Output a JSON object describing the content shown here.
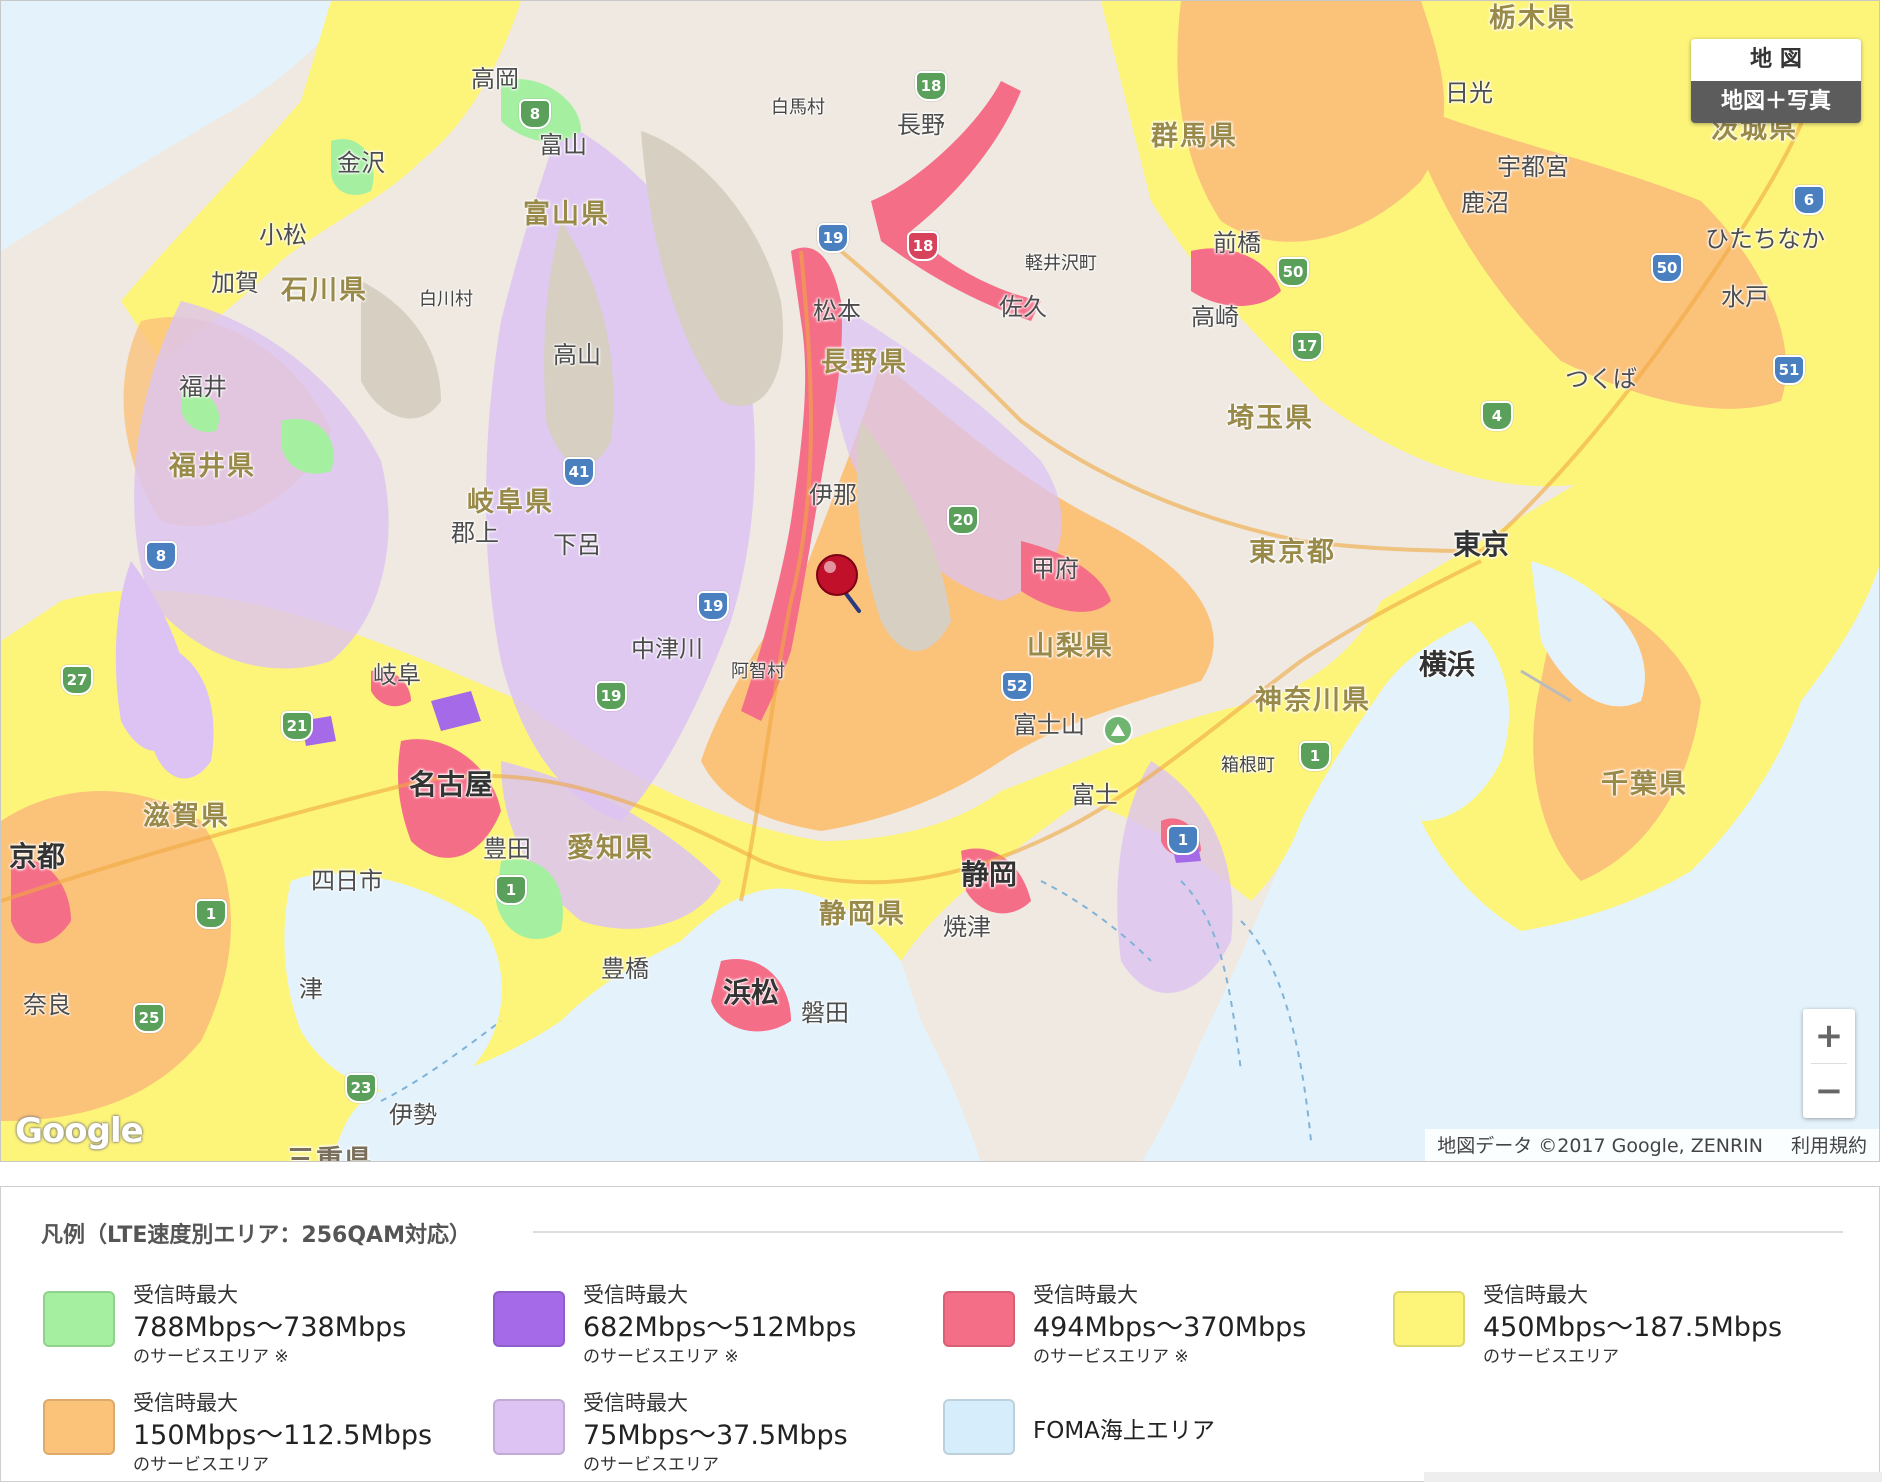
{
  "map": {
    "map_type": {
      "option_map": "地 図",
      "option_hybrid": "地図＋写真",
      "selected": "地図＋写真"
    },
    "zoom": {
      "in": "+",
      "out": "−"
    },
    "google_logo": "Google",
    "attribution": "地図データ ©2017 Google, ZENRIN",
    "terms": "利用規約",
    "colors": {
      "sea": "#e4f3fb",
      "land_base": "#efe9e1",
      "mountain": "#d6cfc2",
      "yellow": "#fdf57a",
      "orange": "#fbc27a",
      "pink": "#f56e88",
      "light_purple": "#dcc3f3",
      "purple": "#a56ae8",
      "green": "#a4f0a0"
    },
    "prefectures": [
      "栃木県",
      "群馬県",
      "富山県",
      "石川県",
      "長野県",
      "茨城県",
      "埼玉県",
      "福井県",
      "岐阜県",
      "東京都",
      "山梨県",
      "神奈川県",
      "千葉県",
      "滋賀県",
      "愛知県",
      "静岡県",
      "京都",
      "三重県"
    ],
    "cities": [
      "高岡",
      "富山",
      "金沢",
      "小松",
      "加賀",
      "白川村",
      "高山",
      "白馬村",
      "長野",
      "日光",
      "宇都宮",
      "鹿沼",
      "前橋",
      "高崎",
      "軽井沢町",
      "佐久",
      "松本",
      "ひたちなか",
      "水戸",
      "つくば",
      "伊那",
      "郡上",
      "下呂",
      "中津川",
      "阿智村",
      "甲府",
      "岐阜",
      "名古屋",
      "豊田",
      "四日市",
      "富士山",
      "箱根町",
      "富士",
      "静岡",
      "焼津",
      "浜松",
      "磐田",
      "豊橋",
      "津",
      "伊勢",
      "奈良",
      "東京",
      "横浜",
      "福井"
    ],
    "route_shields": [
      "18",
      "8",
      "19",
      "18",
      "50",
      "6",
      "50",
      "17",
      "51",
      "4",
      "41",
      "20",
      "8",
      "19",
      "27",
      "19",
      "21",
      "52",
      "1",
      "1",
      "1",
      "25",
      "23",
      "1"
    ],
    "marker": "red-pin"
  },
  "legend": {
    "title": "凡例（LTE速度別エリア：256QAM対応）",
    "items": [
      {
        "line1": "受信時最大",
        "line2": "788Mbps〜738Mbps",
        "line3": "のサービスエリア ※",
        "color": "#a4f0a0"
      },
      {
        "line1": "受信時最大",
        "line2": "682Mbps〜512Mbps",
        "line3": "のサービスエリア ※",
        "color": "#a56ae8"
      },
      {
        "line1": "受信時最大",
        "line2": "494Mbps〜370Mbps",
        "line3": "のサービスエリア ※",
        "color": "#f56e88"
      },
      {
        "line1": "受信時最大",
        "line2": "450Mbps〜187.5Mbps",
        "line3": "のサービスエリア",
        "color": "#fdf57a"
      },
      {
        "line1": "受信時最大",
        "line2": "150Mbps〜112.5Mbps",
        "line3": "のサービスエリア",
        "color": "#fbc27a"
      },
      {
        "line1": "受信時最大",
        "line2": "75Mbps〜37.5Mbps",
        "line3": "のサービスエリア",
        "color": "#dcc3f3"
      },
      {
        "single": "FOMA海上エリア",
        "color": "#d6eefb"
      }
    ]
  }
}
